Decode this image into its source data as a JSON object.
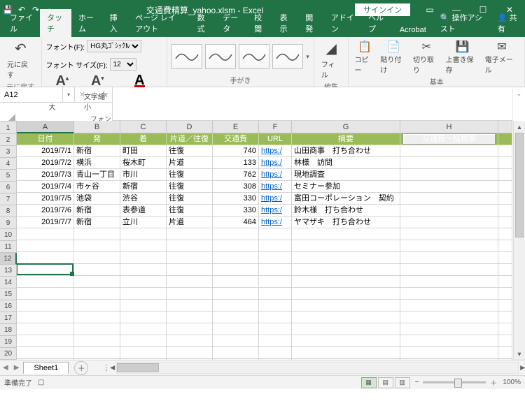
{
  "title": "交通費精算_yahoo.xlsm - Excel",
  "signin": "サインイン",
  "tabs": [
    "ファイル",
    "タッチ",
    "ホーム",
    "挿入",
    "ページ レイアウト",
    "数式",
    "データ",
    "校閲",
    "表示",
    "開発",
    "アドイン",
    "ヘルプ",
    "Acrobat"
  ],
  "active_tab": 1,
  "tell_me": "操作アシスト",
  "share": "共有",
  "ribbon": {
    "undo_group": "元に戻す",
    "undo": "元に戻す",
    "font_group": "フォント",
    "font_label": "フォント(F):",
    "font_value": "HG丸ｺﾞｼｯｸM-",
    "size_label": "フォント サイズ(F):",
    "size_value": "12",
    "grow": "文字拡大",
    "shrink": "文字縮小",
    "font_color": "フォントの色",
    "ink_group": "手がき",
    "edit_group": "編集",
    "fill": "フィル",
    "basic_group": "基本",
    "copy": "コピー",
    "paste": "貼り付け",
    "cut": "切り取り",
    "save": "上書き保存",
    "email": "電子メール"
  },
  "name_box": "A12",
  "columns": [
    "A",
    "B",
    "C",
    "D",
    "E",
    "F",
    "G",
    "H"
  ],
  "header_row": [
    "日付",
    "発",
    "着",
    "片道／往復",
    "交通費",
    "URL",
    "摘要"
  ],
  "search_button": "交通費一括検索",
  "rows": [
    {
      "date": "2019/7/1",
      "from": "新宿",
      "to": "町田",
      "trip": "往復",
      "fare": "740",
      "url": "https:/",
      "note": "山田商事　打ち合わせ"
    },
    {
      "date": "2019/7/2",
      "from": "横浜",
      "to": "桜木町",
      "trip": "片道",
      "fare": "133",
      "url": "https:/",
      "note": "林様　訪問"
    },
    {
      "date": "2019/7/3",
      "from": "青山一丁目",
      "to": "市川",
      "trip": "往復",
      "fare": "762",
      "url": "https:/",
      "note": "現地調査"
    },
    {
      "date": "2019/7/4",
      "from": "市ヶ谷",
      "to": "新宿",
      "trip": "往復",
      "fare": "308",
      "url": "https:/",
      "note": "セミナー参加"
    },
    {
      "date": "2019/7/5",
      "from": "池袋",
      "to": "渋谷",
      "trip": "往復",
      "fare": "330",
      "url": "https:/",
      "note": "富田コーポレーション　契約"
    },
    {
      "date": "2019/7/6",
      "from": "新宿",
      "to": "表参道",
      "trip": "往復",
      "fare": "330",
      "url": "https:/",
      "note": "鈴木様　打ち合わせ"
    },
    {
      "date": "2019/7/7",
      "from": "新宿",
      "to": "立川",
      "trip": "片道",
      "fare": "464",
      "url": "https:/",
      "note": "ヤマザキ　打ち合わせ"
    }
  ],
  "visible_row_count": 20,
  "selected_cell": {
    "row": 12,
    "col": 0
  },
  "sheet_name": "Sheet1",
  "status_ready": "準備完了",
  "zoom": "100%"
}
